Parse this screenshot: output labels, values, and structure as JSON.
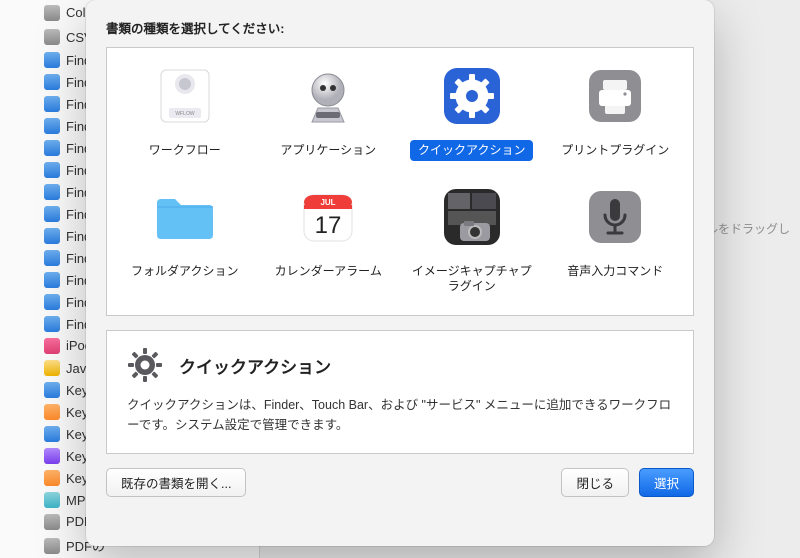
{
  "background": {
    "items": [
      {
        "label": "ColorSync ━━━━━━",
        "iconClass": "gray"
      },
      {
        "label": "CSVを━━━━━",
        "iconClass": "gray"
      },
      {
        "label": "Finde",
        "iconClass": ""
      },
      {
        "label": "Finde",
        "iconClass": ""
      },
      {
        "label": "Finde",
        "iconClass": ""
      },
      {
        "label": "Finde",
        "iconClass": ""
      },
      {
        "label": "Finde",
        "iconClass": ""
      },
      {
        "label": "Finde",
        "iconClass": ""
      },
      {
        "label": "Finde",
        "iconClass": ""
      },
      {
        "label": "Finde",
        "iconClass": ""
      },
      {
        "label": "Finde",
        "iconClass": ""
      },
      {
        "label": "Finde",
        "iconClass": ""
      },
      {
        "label": "Finde",
        "iconClass": ""
      },
      {
        "label": "Finde",
        "iconClass": ""
      },
      {
        "label": "Finde",
        "iconClass": ""
      },
      {
        "label": "iPod ━",
        "iconClass": "pink"
      },
      {
        "label": "JavaS",
        "iconClass": "yellow"
      },
      {
        "label": "Keyn",
        "iconClass": ""
      },
      {
        "label": "Keyn",
        "iconClass": "orange"
      },
      {
        "label": "Keyn",
        "iconClass": ""
      },
      {
        "label": "Keyn",
        "iconClass": "purple"
      },
      {
        "label": "Keyn",
        "iconClass": "orange"
      },
      {
        "label": "MPEG",
        "iconClass": "teal"
      },
      {
        "label": "PDF ━",
        "iconClass": "gray"
      },
      {
        "label": "PDFの",
        "iconClass": "gray"
      }
    ],
    "dragHint": "イルをドラッグし"
  },
  "sheet": {
    "prompt": "書類の種類を選択してください:",
    "tiles": [
      {
        "id": "workflow",
        "label": "ワークフロー",
        "selected": false
      },
      {
        "id": "application",
        "label": "アプリケーション",
        "selected": false
      },
      {
        "id": "quick-action",
        "label": "クイックアクション",
        "selected": true
      },
      {
        "id": "print-plugin",
        "label": "プリントプラグイン",
        "selected": false
      },
      {
        "id": "folder-action",
        "label": "フォルダアクション",
        "selected": false
      },
      {
        "id": "calendar-alarm",
        "label": "カレンダーアラーム",
        "selected": false
      },
      {
        "id": "image-capture-plugin",
        "label": "イメージキャプチャプラグイン",
        "selected": false
      },
      {
        "id": "dictation-command",
        "label": "音声入力コマンド",
        "selected": false
      }
    ],
    "detail": {
      "title": "クイックアクション",
      "text": "クイックアクションは、Finder、Touch Bar、および \"サービス\" メニューに追加できるワークフローです。システム設定で管理できます。"
    },
    "buttons": {
      "openExisting": "既存の書類を開く...",
      "close": "閉じる",
      "choose": "選択"
    }
  }
}
